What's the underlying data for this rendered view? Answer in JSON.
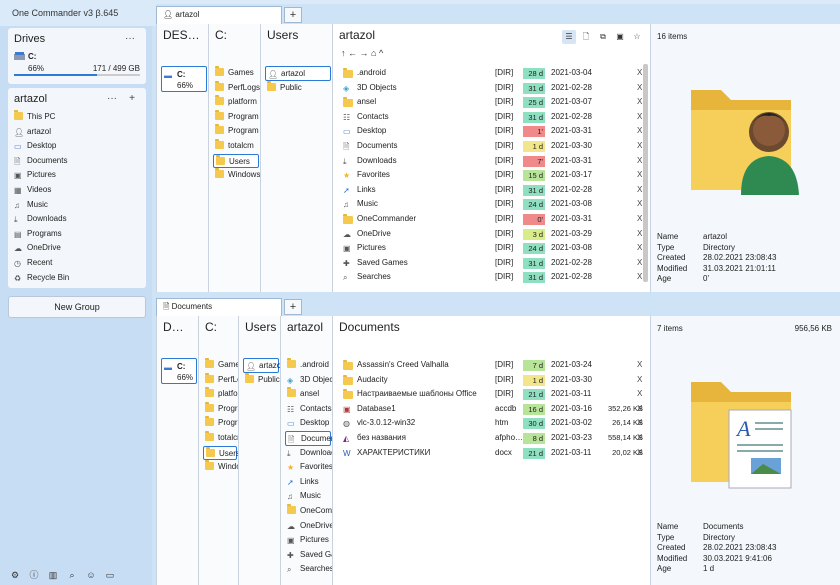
{
  "app": {
    "title": "One Commander v3 β.645"
  },
  "window": {
    "minimize": "─",
    "maximize": "☐",
    "close": "✕"
  },
  "sidebar": {
    "drives_title": "Drives",
    "drives_more": "···",
    "drive": {
      "name": "C:",
      "percent": "66%",
      "usage": "171 / 499 GB",
      "fill": 0.66
    },
    "user_title": "artazol",
    "user_more": "···",
    "user_add": "+",
    "favorites": [
      {
        "label": "This PC",
        "icon": "folder-icon"
      },
      {
        "label": "artazol",
        "icon": "user-icon"
      },
      {
        "label": "Desktop",
        "icon": "desktop-icon"
      },
      {
        "label": "Documents",
        "icon": "documents-icon"
      },
      {
        "label": "Pictures",
        "icon": "pictures-icon"
      },
      {
        "label": "Videos",
        "icon": "videos-icon"
      },
      {
        "label": "Music",
        "icon": "music-icon"
      },
      {
        "label": "Downloads",
        "icon": "downloads-icon"
      },
      {
        "label": "Programs",
        "icon": "programs-icon"
      },
      {
        "label": "OneDrive",
        "icon": "cloud-icon"
      },
      {
        "label": "Recent",
        "icon": "recent-icon"
      },
      {
        "label": "Recycle Bin",
        "icon": "recycle-bin-icon"
      }
    ],
    "new_group": "New Group",
    "bottom_icons": [
      "settings-icon",
      "info-icon",
      "columns-icon",
      "search-icon",
      "user-settings-icon",
      "window-icon"
    ]
  },
  "top_pane": {
    "tab_label": "artazol",
    "columns": [
      {
        "header": "DES…",
        "items": [
          {
            "label": "C:",
            "sub": "66%",
            "selected": true,
            "icon": "drive-icon"
          }
        ]
      },
      {
        "header": "C:",
        "items": [
          {
            "label": "Games",
            "icon": "folder-icon"
          },
          {
            "label": "PerfLogs",
            "icon": "folder-icon"
          },
          {
            "label": "platform",
            "icon": "folder-icon"
          },
          {
            "label": "Program",
            "icon": "folder-icon"
          },
          {
            "label": "Program",
            "icon": "folder-icon"
          },
          {
            "label": "totalcm",
            "icon": "folder-icon"
          },
          {
            "label": "Users",
            "icon": "folder-icon",
            "selected": true
          },
          {
            "label": "Windows",
            "icon": "folder-icon"
          }
        ]
      },
      {
        "header": "Users",
        "items": [
          {
            "label": "artazol",
            "icon": "user-icon",
            "selected": true
          },
          {
            "label": "Public",
            "icon": "folder-icon"
          }
        ]
      }
    ],
    "main": {
      "header": "artazol",
      "nav": "↑ ← → ⌂ ^",
      "files": [
        {
          "name": ".android",
          "ext": "[DIR]",
          "age": "28 d",
          "age_color": "#8fe0c0",
          "date": "2021-03-04",
          "icon": "folder-icon"
        },
        {
          "name": "3D Objects",
          "ext": "[DIR]",
          "age": "31 d",
          "age_color": "#8fe0c0",
          "date": "2021-02-28",
          "icon": "3d-objects-icon"
        },
        {
          "name": "ansel",
          "ext": "[DIR]",
          "age": "25 d",
          "age_color": "#8fe0c0",
          "date": "2021-03-07",
          "icon": "folder-icon"
        },
        {
          "name": "Contacts",
          "ext": "[DIR]",
          "age": "31 d",
          "age_color": "#8fe0c0",
          "date": "2021-02-28",
          "icon": "contacts-icon"
        },
        {
          "name": "Desktop",
          "ext": "[DIR]",
          "age": "1'",
          "age_color": "#f08a8a",
          "date": "2021-03-31",
          "icon": "desktop-icon"
        },
        {
          "name": "Documents",
          "ext": "[DIR]",
          "age": "1 d",
          "age_color": "#f3e68a",
          "date": "2021-03-30",
          "icon": "documents-icon"
        },
        {
          "name": "Downloads",
          "ext": "[DIR]",
          "age": "7'",
          "age_color": "#f08a8a",
          "date": "2021-03-31",
          "icon": "downloads-icon"
        },
        {
          "name": "Favorites",
          "ext": "[DIR]",
          "age": "15 d",
          "age_color": "#b8e49a",
          "date": "2021-03-17",
          "icon": "star-icon"
        },
        {
          "name": "Links",
          "ext": "[DIR]",
          "age": "31 d",
          "age_color": "#8fe0c0",
          "date": "2021-02-28",
          "icon": "links-icon"
        },
        {
          "name": "Music",
          "ext": "[DIR]",
          "age": "24 d",
          "age_color": "#8fe0c0",
          "date": "2021-03-08",
          "icon": "music-icon"
        },
        {
          "name": "OneCommander",
          "ext": "[DIR]",
          "age": "0'",
          "age_color": "#f08a8a",
          "date": "2021-03-31",
          "icon": "folder-icon"
        },
        {
          "name": "OneDrive",
          "ext": "[DIR]",
          "age": "3 d",
          "age_color": "#d8ec8a",
          "date": "2021-03-29",
          "icon": "cloud-icon"
        },
        {
          "name": "Pictures",
          "ext": "[DIR]",
          "age": "24 d",
          "age_color": "#8fe0c0",
          "date": "2021-03-08",
          "icon": "pictures-icon"
        },
        {
          "name": "Saved Games",
          "ext": "[DIR]",
          "age": "31 d",
          "age_color": "#8fe0c0",
          "date": "2021-02-28",
          "icon": "saved-games-icon"
        },
        {
          "name": "Searches",
          "ext": "[DIR]",
          "age": "31 d",
          "age_color": "#8fe0c0",
          "date": "2021-02-28",
          "icon": "search-icon"
        }
      ],
      "close_mark": "X"
    },
    "info": {
      "count": "16 items",
      "props": [
        {
          "k": "Name",
          "v": "artazol"
        },
        {
          "k": "Type",
          "v": "Directory"
        },
        {
          "k": "Created",
          "v": "28.02.2021 23:08:43"
        },
        {
          "k": "Modified",
          "v": "31.03.2021 21:01:11"
        },
        {
          "k": "Age",
          "v": "0'"
        }
      ]
    }
  },
  "bottom_pane": {
    "tab_label": "Documents",
    "columns": [
      {
        "header": "D…",
        "items": [
          {
            "label": "C:",
            "sub": "66%",
            "selected": true,
            "icon": "drive-icon"
          }
        ]
      },
      {
        "header": "C:",
        "items": [
          {
            "label": "Games",
            "icon": "folder-icon"
          },
          {
            "label": "PerfLogs",
            "icon": "folder-icon"
          },
          {
            "label": "platform",
            "icon": "folder-icon"
          },
          {
            "label": "Program",
            "icon": "folder-icon"
          },
          {
            "label": "Program",
            "icon": "folder-icon"
          },
          {
            "label": "totalcm",
            "icon": "folder-icon"
          },
          {
            "label": "Users",
            "icon": "folder-icon",
            "selected": true
          },
          {
            "label": "Windows",
            "icon": "folder-icon"
          }
        ]
      },
      {
        "header": "Users",
        "items": [
          {
            "label": "artazol",
            "icon": "user-icon",
            "selected": true
          },
          {
            "label": "Public",
            "icon": "folder-icon"
          }
        ]
      },
      {
        "header": "artazol",
        "items": [
          {
            "label": ".android",
            "icon": "folder-icon"
          },
          {
            "label": "3D Objects",
            "icon": "3d-objects-icon"
          },
          {
            "label": "ansel",
            "icon": "folder-icon"
          },
          {
            "label": "Contacts",
            "icon": "contacts-icon"
          },
          {
            "label": "Desktop",
            "icon": "desktop-icon"
          },
          {
            "label": "Documents",
            "icon": "documents-icon",
            "selected": true
          },
          {
            "label": "Downloads",
            "icon": "downloads-icon"
          },
          {
            "label": "Favorites",
            "icon": "star-icon"
          },
          {
            "label": "Links",
            "icon": "links-icon"
          },
          {
            "label": "Music",
            "icon": "music-icon"
          },
          {
            "label": "OneCommander",
            "icon": "folder-icon"
          },
          {
            "label": "OneDrive",
            "icon": "cloud-icon"
          },
          {
            "label": "Pictures",
            "icon": "pictures-icon"
          },
          {
            "label": "Saved Games",
            "icon": "saved-games-icon"
          },
          {
            "label": "Searches",
            "icon": "search-icon"
          }
        ]
      }
    ],
    "main": {
      "header": "Documents",
      "files": [
        {
          "name": "Assassin's Creed Valhalla",
          "ext": "[DIR]",
          "age": "7 d",
          "age_color": "#b8e49a",
          "date": "2021-03-24",
          "size": "",
          "icon": "folder-icon"
        },
        {
          "name": "Audacity",
          "ext": "[DIR]",
          "age": "1 d",
          "age_color": "#f3e68a",
          "date": "2021-03-30",
          "size": "",
          "icon": "folder-icon"
        },
        {
          "name": "Настраиваемые шаблоны Office",
          "ext": "[DIR]",
          "age": "21 d",
          "age_color": "#8fe0c0",
          "date": "2021-03-11",
          "size": "",
          "icon": "folder-icon"
        },
        {
          "name": "Database1",
          "ext": "accdb",
          "age": "16 d",
          "age_color": "#b8e49a",
          "date": "2021-03-16",
          "size": "352,26 KB",
          "icon": "database-icon"
        },
        {
          "name": "vlc-3.0.12-win32",
          "ext": "htm",
          "age": "30 d",
          "age_color": "#8fe0c0",
          "date": "2021-03-02",
          "size": "26,14 KB",
          "icon": "web-file-icon"
        },
        {
          "name": "без названия",
          "ext": "afpho…",
          "age": "8 d",
          "age_color": "#b8e49a",
          "date": "2021-03-23",
          "size": "558,14 KB",
          "icon": "affinity-photo-icon"
        },
        {
          "name": "ХАРАКТЕРИСТИКИ",
          "ext": "docx",
          "age": "21 d",
          "age_color": "#8fe0c0",
          "date": "2021-03-11",
          "size": "20,02 KB",
          "icon": "word-icon"
        }
      ],
      "close_mark": "X"
    },
    "info": {
      "count": "7 items",
      "total": "956,56 KB",
      "props": [
        {
          "k": "Name",
          "v": "Documents"
        },
        {
          "k": "Type",
          "v": "Directory"
        },
        {
          "k": "Created",
          "v": "28.02.2021 23:08:43"
        },
        {
          "k": "Modified",
          "v": "30.03.2021 9:41:06"
        },
        {
          "k": "Age",
          "v": "1 d"
        }
      ]
    }
  },
  "icon_colors": {
    "folder-icon": "#f4c94e",
    "user-icon": "#555",
    "desktop-icon": "#3c7bd0",
    "documents-icon": "#555",
    "pictures-icon": "#555",
    "videos-icon": "#555",
    "music-icon": "#555",
    "downloads-icon": "#555",
    "programs-icon": "#555",
    "cloud-icon": "#555",
    "recent-icon": "#555",
    "recycle-bin-icon": "#555",
    "3d-objects-icon": "#3c9fd0",
    "contacts-icon": "#555",
    "star-icon": "#f2b233",
    "links-icon": "#2d6fcf",
    "saved-games-icon": "#555",
    "search-icon": "#555",
    "drive-icon": "#3c7bd0",
    "database-icon": "#b03a3a",
    "web-file-icon": "#555",
    "affinity-photo-icon": "#7a2a8a",
    "word-icon": "#2b5bb0"
  }
}
